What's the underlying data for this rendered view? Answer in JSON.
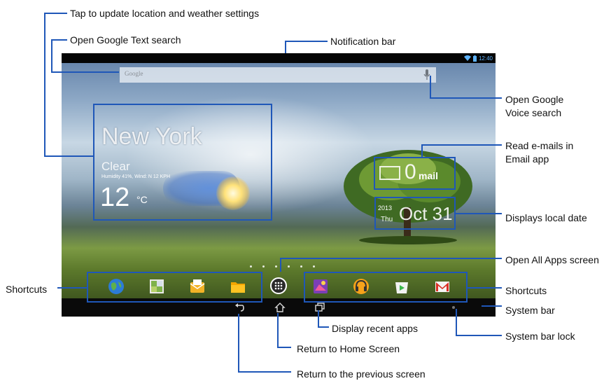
{
  "callouts": {
    "weather_settings": "Tap to update location and weather settings",
    "text_search": "Open Google Text search",
    "notification_bar": "Notification bar",
    "voice_search_1": "Open Google",
    "voice_search_2": "Voice search",
    "email_1": "Read e-mails in",
    "email_2": "Email app",
    "local_date": "Displays local date",
    "all_apps": "Open All Apps screen",
    "shortcuts_left": "Shortcuts",
    "shortcuts_right": "Shortcuts",
    "system_bar": "System bar",
    "system_bar_lock": "System bar lock",
    "recent_apps": "Display recent apps",
    "home_screen": "Return to Home Screen",
    "previous_screen": "Return to the previous screen"
  },
  "notification": {
    "time": "12:40",
    "icons": [
      "wifi-icon",
      "battery-icon"
    ]
  },
  "search": {
    "placeholder": "Google",
    "mic_icon": "mic-icon"
  },
  "weather": {
    "city": "New York",
    "condition": "Clear",
    "details": "Humidity 41%, Wind: N 12 KPH",
    "temperature": "12",
    "unit": "°C"
  },
  "email_widget": {
    "count": "0",
    "label": "mail"
  },
  "date_widget": {
    "year": "2013",
    "weekday": "Thu",
    "date": "Oct 31"
  },
  "dock": {
    "left": [
      "browser-icon",
      "gallery-icon",
      "email-icon",
      "file-manager-icon"
    ],
    "center": "all-apps-icon",
    "right": [
      "photo-icon",
      "play-music-icon",
      "play-store-icon",
      "gmail-icon"
    ]
  },
  "system_bar": {
    "buttons": [
      "back-icon",
      "home-icon",
      "recent-apps-icon",
      "lock-icon"
    ]
  },
  "colors": {
    "annotation": "#1f57b8",
    "bar": "#050505",
    "status_accent": "#5fb4ff"
  }
}
